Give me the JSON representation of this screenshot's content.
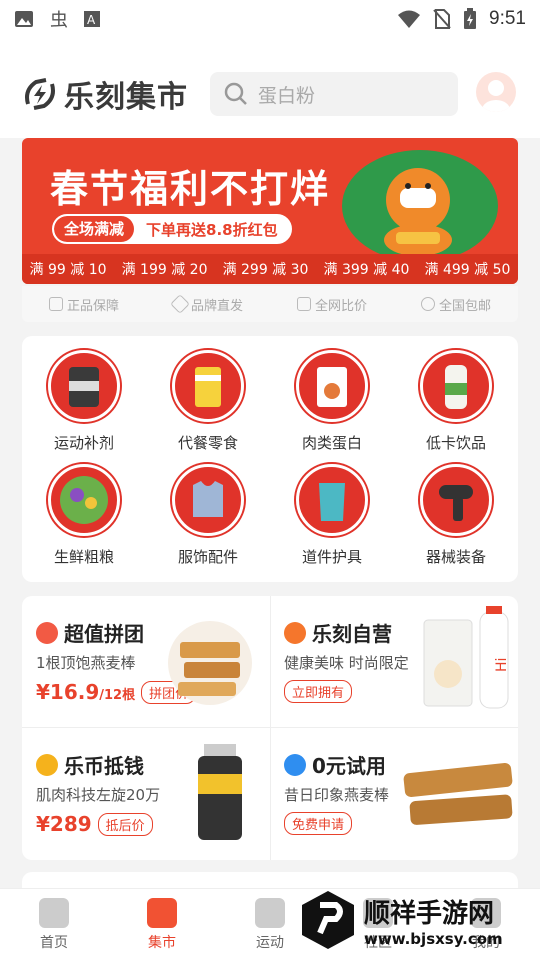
{
  "status": {
    "time": "9:51"
  },
  "header": {
    "brand": "乐刻集市",
    "search_placeholder": "蛋白粉"
  },
  "banner": {
    "title": "春节福利不打烊",
    "pill_left": "全场满减",
    "pill_right": "下单再送8.8折红包",
    "deals": [
      "满 99 减 10",
      "满 199 减 20",
      "满 299 减 30",
      "满 399 减 40",
      "满 499 减 50"
    ]
  },
  "guarantees": [
    "正品保障",
    "品牌直发",
    "全网比价",
    "全国包邮"
  ],
  "categories": [
    "运动补剂",
    "代餐零食",
    "肉类蛋白",
    "低卡饮品",
    "生鲜粗粮",
    "服饰配件",
    "道件护具",
    "器械装备"
  ],
  "promos": [
    {
      "title": "超值拼团",
      "sub": "1根顶饱燕麦棒",
      "price": "¥16.9",
      "unit": "/12根",
      "tag": "拼团价",
      "icon_color": "#f25a44"
    },
    {
      "title": "乐刻自营",
      "sub": "健康美味 时尚限定",
      "price": "",
      "unit": "",
      "tag": "立即拥有",
      "icon_color": "#f5762c"
    },
    {
      "title": "乐币抵钱",
      "sub": "肌肉科技左旋20万",
      "price": "¥289",
      "unit": "",
      "tag": "抵后价",
      "icon_color": "#f5b21c"
    },
    {
      "title": "0元试用",
      "sub": "昔日印象燕麦棒",
      "price": "",
      "unit": "",
      "tag": "免费申请",
      "icon_color": "#2f8ef0"
    }
  ],
  "tabs": [
    "首页",
    "集市",
    "运动",
    "社区",
    "我的"
  ],
  "watermark": {
    "name": "顺祥手游网",
    "url": "www.bjsxsy.com"
  }
}
